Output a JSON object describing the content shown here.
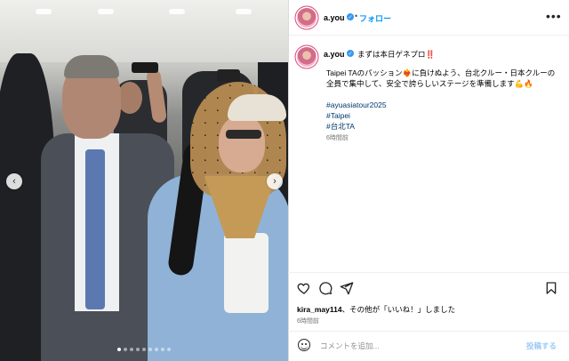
{
  "post": {
    "username": "a.you",
    "follow_label": "フォロー",
    "bullet": "•",
    "more_icon": "more-dots-icon",
    "caption_title": "まずは本日ゲネプロ‼️",
    "caption_body": "Taipei TAのパッション❤️‍🔥に負けぬよう、台北クルー・日本クルーの全員で集中して、安全で誇らしいステージを準備します💪🔥",
    "hashtags": [
      "#ayuasiatour2025",
      "#Taipei",
      "#台北TA"
    ],
    "caption_time": "6時間前",
    "likes_user": "kira_may114",
    "likes_text": "、その他が「いいね！」しました",
    "likes_time": "6時間前",
    "comment_placeholder": "コメントを追加...",
    "post_label": "投稿する"
  },
  "carousel": {
    "prev_icon": "chevron-left-icon",
    "next_icon": "chevron-right-icon",
    "dot_count": 9,
    "active_dot": 0
  },
  "colors": {
    "accent": "#0095f6",
    "verified": "#3897f0",
    "hashtag": "#00376b",
    "post_disabled": "#9ccbf5"
  }
}
